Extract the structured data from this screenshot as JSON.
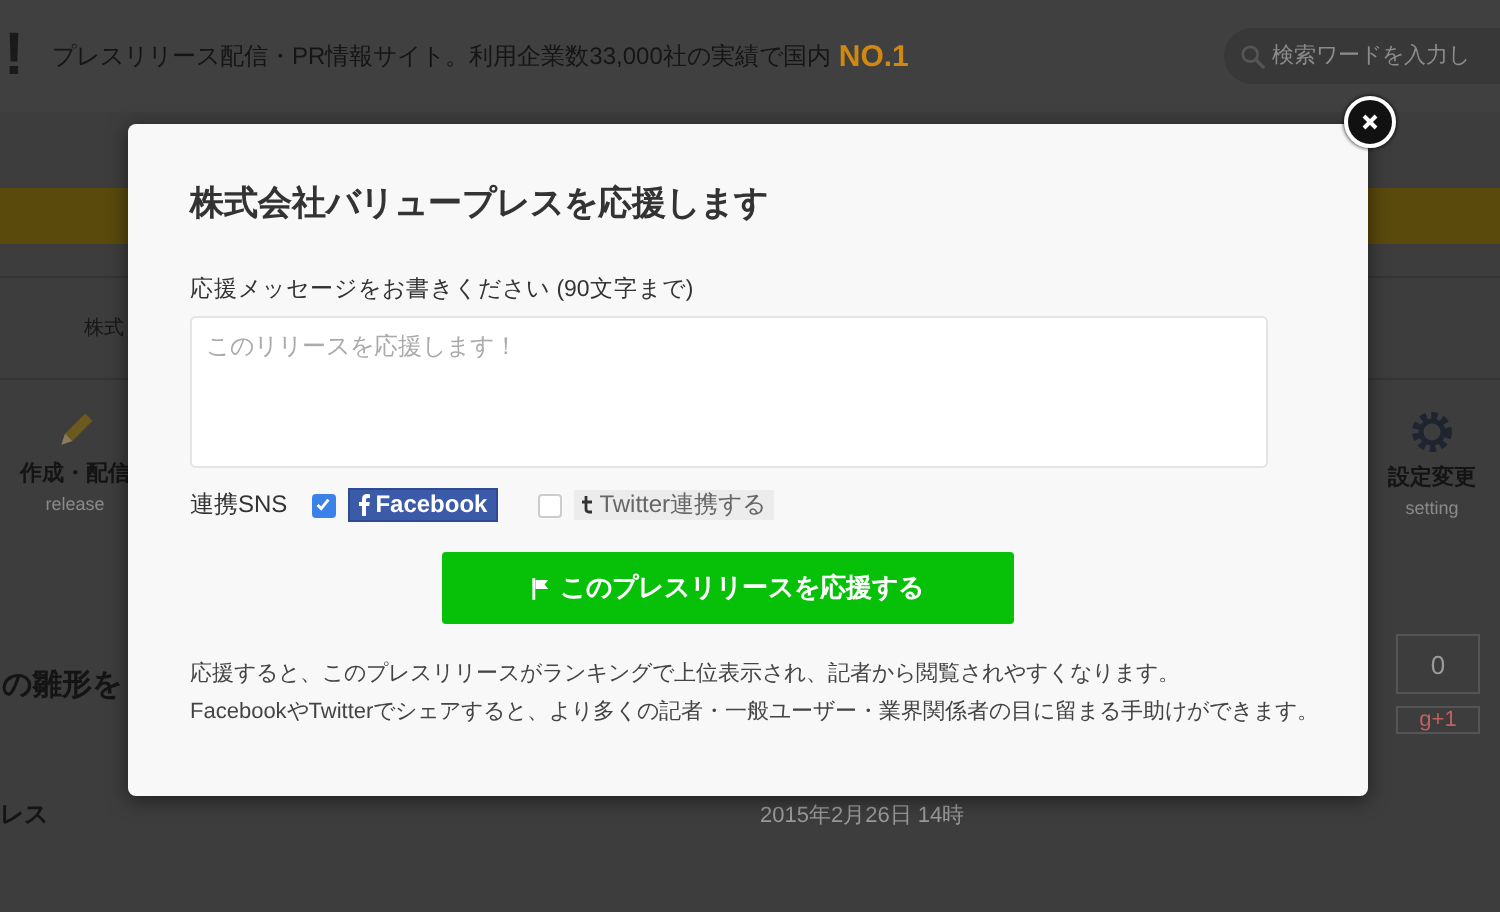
{
  "header": {
    "logo": "!",
    "tagline": "プレスリリース配信・PR情報サイト。利用企業数33,000社の実績で国内",
    "badge": "NO.1",
    "search": {
      "placeholder": "検索ワードを入力し"
    }
  },
  "breadcrumbs": {
    "left": [
      "株式"
    ]
  },
  "tools": [
    {
      "kind": "pencil",
      "label": "作成・配信",
      "sub": "release"
    },
    {
      "kind": "gear",
      "label": "設定変更",
      "sub": "setting"
    }
  ],
  "article": {
    "title": "の雛形を",
    "counter": "0",
    "gplus": "g+1",
    "company": "レス",
    "date": "2015年2月26日 14時"
  },
  "modal": {
    "title": "株式会社バリュープレスを応援します",
    "message_label": "応援メッセージをお書きください (90文字まで)",
    "message": {
      "placeholder": "このリリースを応援します！"
    },
    "sns_label": "連携SNS",
    "sns": [
      {
        "kind": "facebook",
        "label": "Facebook",
        "checked": true
      },
      {
        "kind": "twitter",
        "label": "Twitter連携する",
        "checked": false
      }
    ],
    "button": "このプレスリリースを応援する",
    "notes": [
      "応援すると、このプレスリリースがランキングで上位表示され、記者から閲覧されやすくなります。",
      "FacebookやTwitterでシェアすると、より多くの記者・一般ユーザー・業界関係者の目に留まる手助けができます。"
    ]
  }
}
